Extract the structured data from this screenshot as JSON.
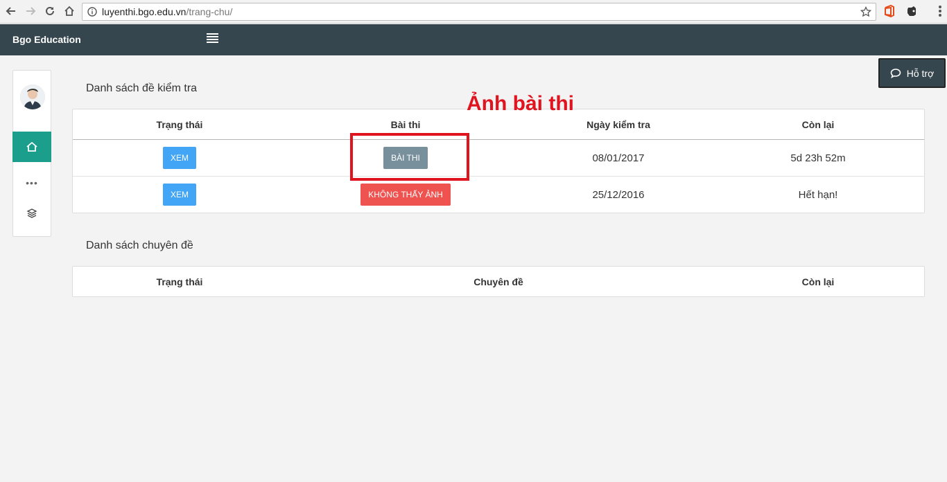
{
  "browser": {
    "url_host": "luyenthi.bgo.edu.vn",
    "url_path": "/trang-chu/"
  },
  "header": {
    "brand": "Bgo Education"
  },
  "support": {
    "label": "Hỗ trợ"
  },
  "sidebar": {
    "more_label": "•••"
  },
  "exams": {
    "title": "Danh sách đề kiểm tra",
    "columns": [
      "Trạng thái",
      "Bài thi",
      "Ngày kiểm tra",
      "Còn lại"
    ],
    "rows": [
      {
        "status_btn": "XEM",
        "exam_btn": "BÀI THI",
        "date": "08/01/2017",
        "remaining": "5d 23h 52m"
      },
      {
        "status_btn": "XEM",
        "exam_btn": "KHÔNG THẤY ẢNH",
        "date": "25/12/2016",
        "remaining": "Hết hạn!"
      }
    ]
  },
  "topics": {
    "title": "Danh sách chuyên đề",
    "columns": [
      "Trạng thái",
      "Chuyên đề",
      "Còn lại"
    ]
  },
  "annotation": {
    "text": "Ảnh bài thi",
    "color": "#e0141e"
  },
  "colors": {
    "header_bg": "#36464f",
    "accent_teal": "#1b9e8c",
    "btn_blue": "#42a5f5",
    "btn_grey": "#78909c",
    "btn_red": "#ef5350"
  }
}
